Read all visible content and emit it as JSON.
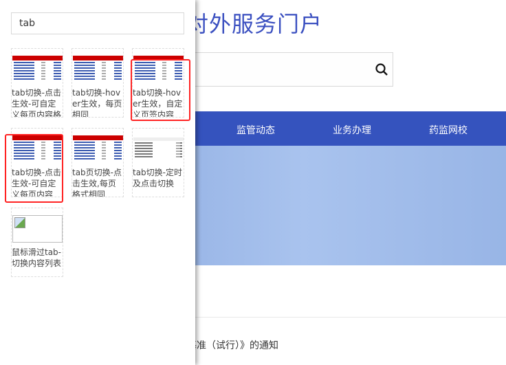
{
  "page": {
    "title": "理局对外服务门户",
    "nav": [
      "监管动态",
      "业务办理",
      "药监网校"
    ],
    "notice": "裁量基准（试行）》的通知",
    "search_icon": "search-icon"
  },
  "panel": {
    "search_value": "tab",
    "results": [
      {
        "label": "tab切换-点击生效-可自定义每页内容格",
        "thumb": "red-table"
      },
      {
        "label": "tab切换-hover生效，每页相同",
        "thumb": "red-table"
      },
      {
        "label": "tab切换-hover生效，自定义页签内容",
        "thumb": "red-table",
        "highlighted": true
      },
      {
        "label": "tab切换-点击生效-可自定义每页内容",
        "thumb": "red-table",
        "highlighted": true
      },
      {
        "label": "tab页切换-点击生效,每页格式相同",
        "thumb": "red-table"
      },
      {
        "label": "tab切换-定时及点击切换",
        "thumb": "plain-list"
      },
      {
        "label": "鼠标滑过tab-切换内容列表",
        "thumb": "broken-image"
      }
    ],
    "highlight_color": "#ff2222"
  }
}
